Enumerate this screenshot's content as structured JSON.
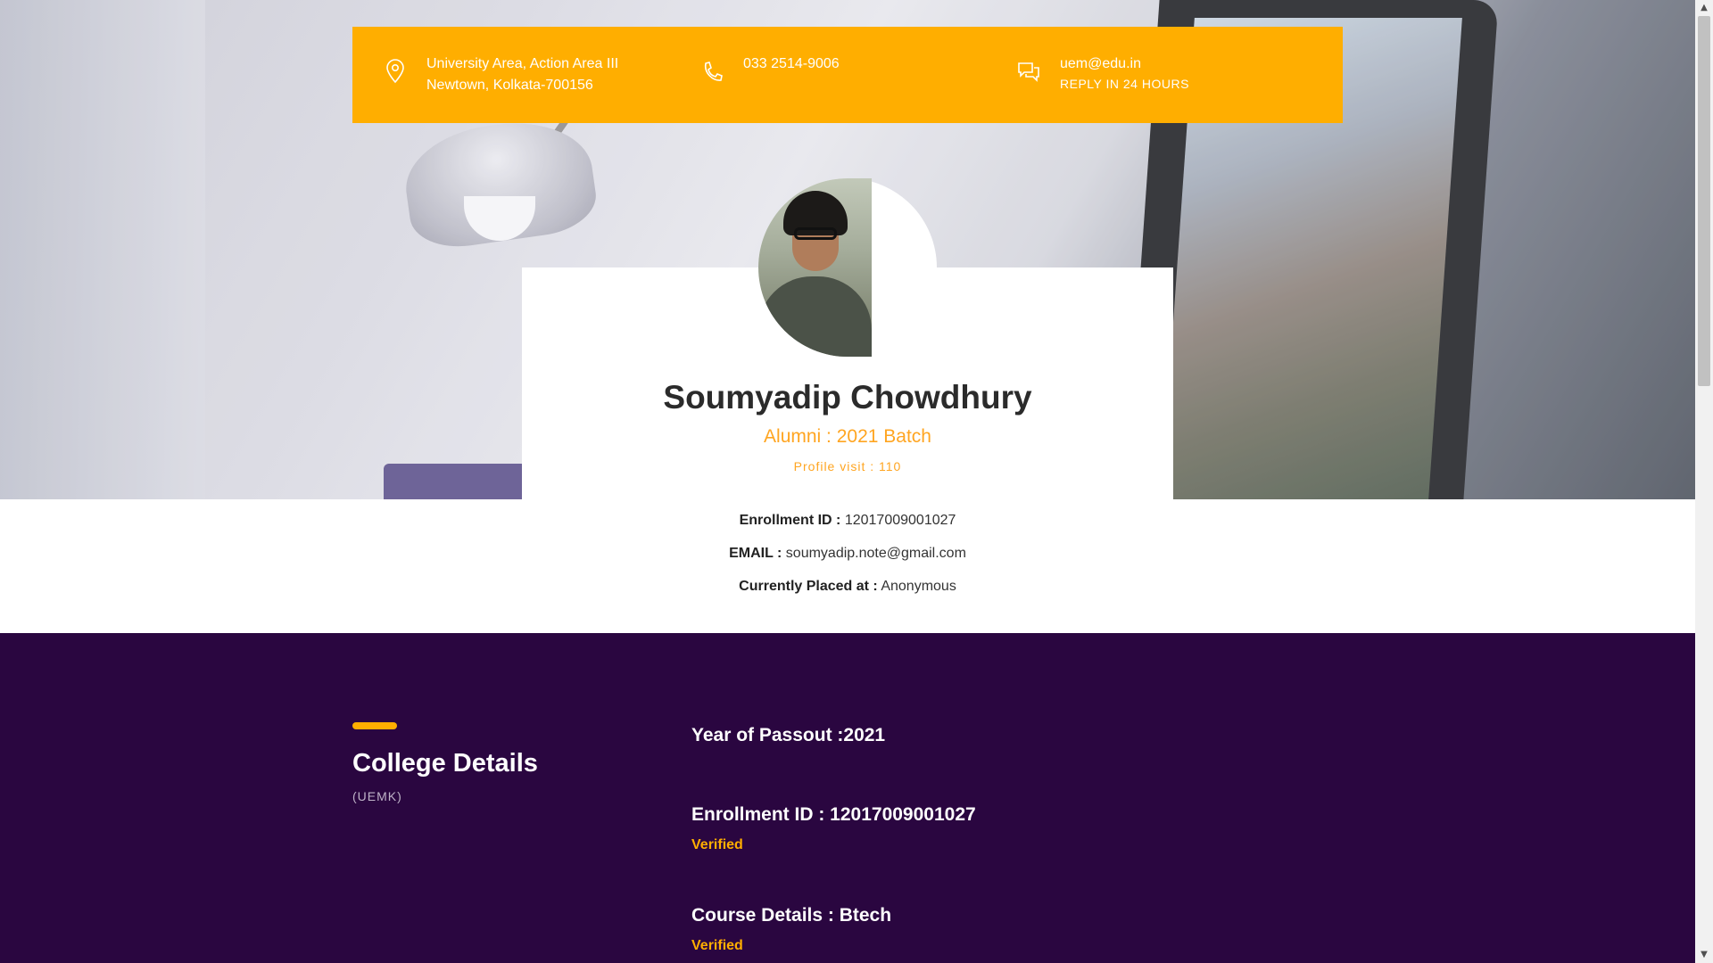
{
  "contact": {
    "address_line1": "University Area, Action Area III",
    "address_line2": "Newtown, Kolkata-700156",
    "phone": "033 2514-9006",
    "email": "uem@edu.in",
    "email_note": "REPLY IN 24 HOURS"
  },
  "profile": {
    "name": "Soumyadip Chowdhury",
    "alumni": "Alumni : 2021 Batch",
    "visits": "Profile visit : 110",
    "enrollment_label": "Enrollment ID :",
    "enrollment_value": "12017009001027",
    "email_label": "EMAIL :",
    "email_value": "soumyadip.note@gmail.com",
    "placed_label": "Currently Placed at :",
    "placed_value": "Anonymous"
  },
  "college": {
    "title": "College Details",
    "subtitle": "(UEMK)",
    "year_of_passout": "Year of Passout :2021",
    "enrollment": "Enrollment ID : 12017009001027",
    "enrollment_status": "Verified",
    "course": "Course Details : Btech",
    "course_status": "Verified"
  },
  "icons": {
    "location": "map-pin-icon",
    "phone": "phone-icon",
    "chat": "chat-icon"
  },
  "colors": {
    "accent": "#ffae00",
    "section_bg": "#2a0640",
    "highlight_text": "#ffa521"
  }
}
